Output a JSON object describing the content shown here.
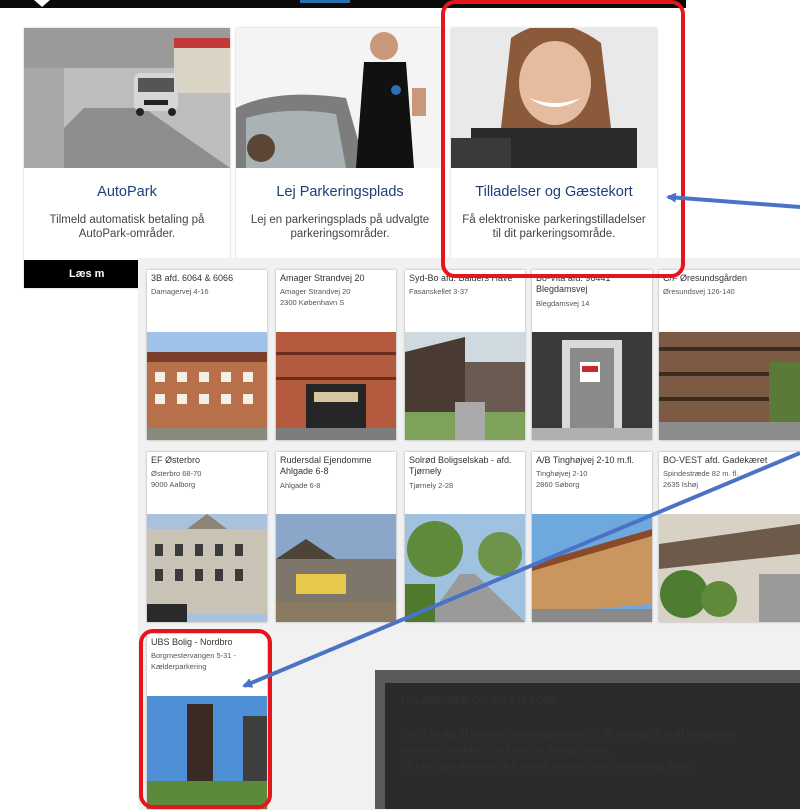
{
  "cards": [
    {
      "title": "AutoPark",
      "desc": "Tilmeld automatisk betaling på AutoPark-områder.",
      "more": "Læs m"
    },
    {
      "title": "Lej Parkeringsplads",
      "desc": "Lej en parkeringsplads på udvalgte parkeringsområder."
    },
    {
      "title": "Tilladelser og Gæstekort",
      "desc": "Få elektroniske parkeringstilladelser til dit parkeringsområde."
    }
  ],
  "tiles": [
    {
      "name": "3B afd. 6064 & 6066",
      "l1": "Damagervej 4-16",
      "l2": ""
    },
    {
      "name": "Amager Strandvej 20",
      "l1": "Amager Strandvej 20",
      "l2": "2300 København S"
    },
    {
      "name": "Syd-Bo afd. Balders Have",
      "l1": "Fasanskellet 3-37",
      "l2": ""
    },
    {
      "name": "Bo-Vita afd. 96441 Blegdamsvej",
      "l1": "Blegdamsvej 14",
      "l2": ""
    },
    {
      "name": "C/F Øresundsgården",
      "l1": "Øresundsvej 126-140",
      "l2": ""
    },
    {
      "name": "EF Østerbro",
      "l1": "Østerbro 68-70",
      "l2": "9000 Aalborg"
    },
    {
      "name": "Rudersdal Ejendomme Ahlgade 6-8",
      "l1": "Ahlgade 6-8",
      "l2": ""
    },
    {
      "name": "Solrød Boligselskab - afd. Tjørnely",
      "l1": "Tjørnely 2-28",
      "l2": ""
    },
    {
      "name": "A/B Tinghøjvej 2-10 m.fl.",
      "l1": "Tinghøjvej 2-10",
      "l2": "2860 Søborg"
    },
    {
      "name": "BO-VEST afd. Gadekæret",
      "l1": "Spindestræde 82 m. fl.",
      "l2": "2635 Ishøj"
    },
    {
      "name": "UBS Bolig - Nordbro",
      "l1": "Borgmestervangen 5-31 -",
      "l2": "Kælderparkering"
    }
  ],
  "dialog": {
    "title": "TILLADELSER OG GÆSTEKORT",
    "line1": "Det er muligt at udstede parkeringslicenser til dit køretøj på et af områderne",
    "line2": "relevante område for at læse om betingelserne.",
    "line3": "Du kan også anvende den mobile version https://www.mitcp.dk/m"
  },
  "colors": {
    "highlight": "#e8141b",
    "arrow": "#4a73c6",
    "title": "#1c3f7a"
  }
}
